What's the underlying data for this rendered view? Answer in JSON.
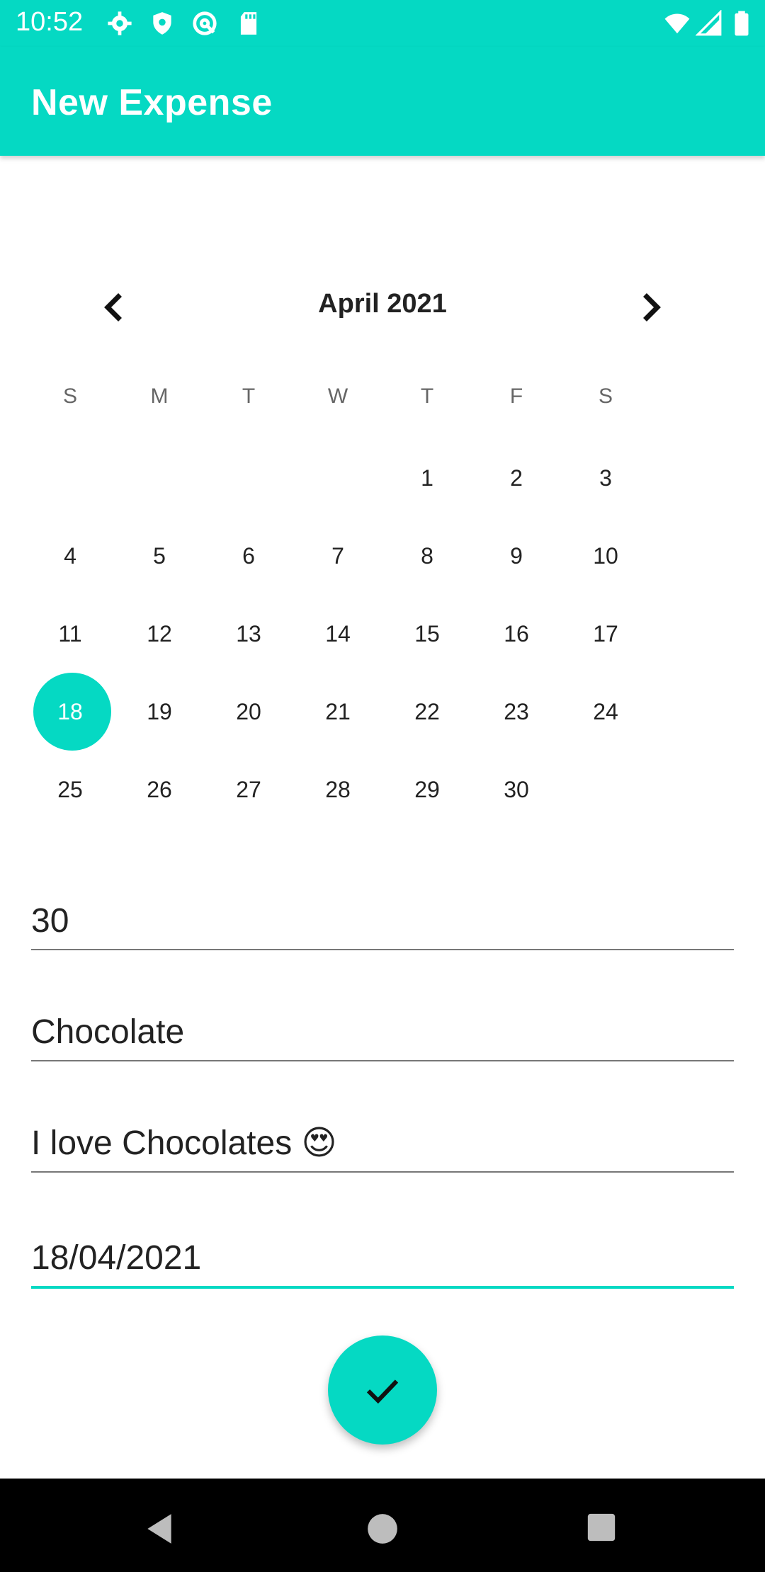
{
  "status_bar": {
    "time": "10:52",
    "icons": [
      "settings-icon",
      "shield-icon",
      "at-sign-icon",
      "sd-card-icon",
      "wifi-icon",
      "signal-icon",
      "battery-icon"
    ]
  },
  "app_bar": {
    "title": "New Expense"
  },
  "calendar": {
    "month_label": "April 2021",
    "weekdays": [
      "S",
      "M",
      "T",
      "W",
      "T",
      "F",
      "S"
    ],
    "weeks": [
      [
        "",
        "",
        "",
        "",
        "1",
        "2",
        "3"
      ],
      [
        "4",
        "5",
        "6",
        "7",
        "8",
        "9",
        "10"
      ],
      [
        "11",
        "12",
        "13",
        "14",
        "15",
        "16",
        "17"
      ],
      [
        "18",
        "19",
        "20",
        "21",
        "22",
        "23",
        "24"
      ],
      [
        "25",
        "26",
        "27",
        "28",
        "29",
        "30",
        ""
      ]
    ],
    "selected_day": "18"
  },
  "form": {
    "amount": "30",
    "name": "Chocolate",
    "description": "I love Chocolates 😍",
    "date": "18/04/2021"
  },
  "colors": {
    "accent": "#05D9C3",
    "nav_bar": "#000000"
  },
  "fab": {
    "icon": "check-icon"
  },
  "nav": {
    "icons": [
      "back-icon",
      "home-icon",
      "recents-icon"
    ]
  }
}
